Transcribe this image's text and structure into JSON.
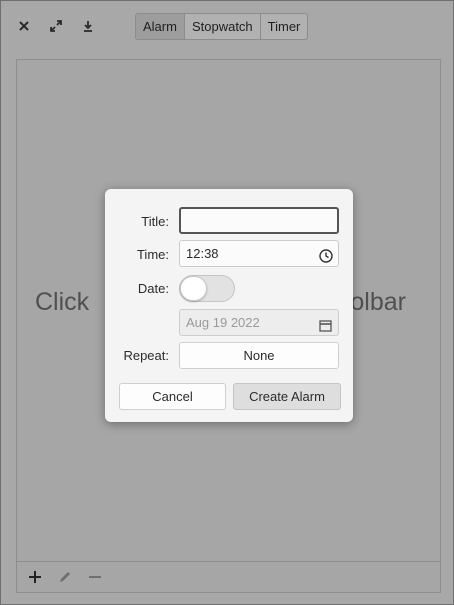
{
  "header": {
    "tabs": [
      {
        "label": "Alarm",
        "active": true
      },
      {
        "label": "Stopwatch",
        "active": false
      },
      {
        "label": "Timer",
        "active": false
      }
    ],
    "icons": [
      "close-icon",
      "maximize-icon",
      "download-icon"
    ]
  },
  "main": {
    "empty_left": "Click",
    "empty_right": "olbar"
  },
  "bottom_bar": {
    "icons": [
      "add-icon",
      "edit-icon",
      "remove-icon"
    ]
  },
  "dialog": {
    "title_label": "Title:",
    "title_value": "",
    "time_label": "Time:",
    "time_value": "12:38",
    "date_label": "Date:",
    "date_switch_on": false,
    "date_value": "Aug 19 2022",
    "repeat_label": "Repeat:",
    "repeat_value": "None",
    "cancel_label": "Cancel",
    "create_label": "Create Alarm"
  }
}
